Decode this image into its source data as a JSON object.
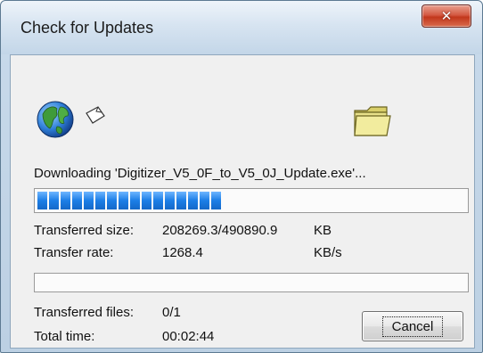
{
  "window": {
    "title": "Check for Updates",
    "close_icon": "close-x-icon"
  },
  "animation": {
    "source_icon": "globe-icon",
    "paper_icon": "paper-icon",
    "target_icon": "folder-icon"
  },
  "status_text": "Downloading 'Digitizer_V5_0F_to_V5_0J_Update.exe'...",
  "file_progress": 0.43,
  "stats": {
    "transferred_size_label": "Transferred size:",
    "transferred_size_value": "208269.3/490890.9",
    "transferred_size_unit": "KB",
    "transfer_rate_label": "Transfer rate:",
    "transfer_rate_value": "1268.4",
    "transfer_rate_unit": "KB/s"
  },
  "overall_progress": 0.0,
  "summary": {
    "transferred_files_label": "Transferred files:",
    "transferred_files_value": "0/1",
    "total_time_label": "Total time:",
    "total_time_value": "00:02:44"
  },
  "buttons": {
    "cancel": "Cancel"
  },
  "colors": {
    "progress_fill": "#1c7ee6",
    "close_button": "#c2371c",
    "folder": "#e8e08a"
  }
}
